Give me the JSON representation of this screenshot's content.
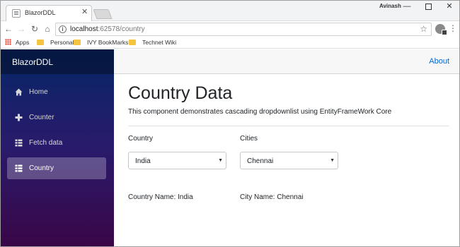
{
  "browser": {
    "tab_title": "BlazorDDL",
    "user": "Avinash",
    "url_host": "localhost",
    "url_rest": ":62578/country",
    "bookmarks": [
      "Apps",
      "Personal",
      "IVY BookMarks",
      "Technet Wiki"
    ]
  },
  "app": {
    "brand": "BlazorDDL",
    "about": "About",
    "nav": [
      {
        "label": "Home",
        "icon": "home-icon"
      },
      {
        "label": "Counter",
        "icon": "plus-icon"
      },
      {
        "label": "Fetch data",
        "icon": "list-icon"
      },
      {
        "label": "Country",
        "icon": "list-icon"
      }
    ],
    "active_nav": "Country"
  },
  "main": {
    "title": "Country Data",
    "description": "This component demonstrates cascading dropdownlist using EntityFrameWork Core",
    "country_label": "Country",
    "cities_label": "Cities",
    "country_selected": "India",
    "city_selected": "Chennai",
    "country_name_text": "Country Name: India",
    "city_name_text": "City Name: Chennai"
  },
  "colors": {
    "sidebar_top": "#052767",
    "sidebar_bottom": "#3a0647",
    "link": "#0366d6"
  }
}
